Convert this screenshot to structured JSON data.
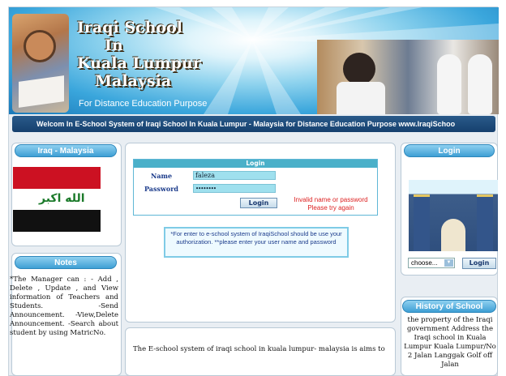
{
  "header": {
    "title_lines": [
      "Iraqi School",
      "In",
      "Kuala Lumpur",
      "Malaysia"
    ],
    "subtitle": "For Distance Education Purpose",
    "marquee": "Welcom In E-School System of Iraqi School In Kuala Lumpur - Malaysia for Distance Education Purpose www.IraqiSchoo"
  },
  "left": {
    "flag_title": "Iraq - Malaysia",
    "flag_text": "الله اكبر",
    "notes_title": "Notes",
    "notes_text": "*The Manager can : - Add , Delete , Update , and View information of Teachers and Students. -Send Announcement. -View,Delete Announcement. -Search about student by using MatricNo."
  },
  "login": {
    "header": "Login",
    "name_label": "Name",
    "name_value": "faleza",
    "password_label": "Password",
    "password_value": "••••••••",
    "button": "Login",
    "error": "Invalid name or password Please try again",
    "info": "*For enter to e-school system of IraqiSchool should be use your authorization. **please enter your user name and password",
    "intro": "The E-school system of iraqi school in kuala lumpur- malaysia is aims to"
  },
  "right": {
    "login_title": "Login",
    "select_value": "choose...",
    "login_button": "Login",
    "history_title": "History of School",
    "history_text": "the property of the Iraqi government Address the Iraqi school in Kuala Lumpur Kuala Lumpur/No 2 Jalan Langgak Golf off Jalan"
  },
  "colors": {
    "accent": "#3e9fd4",
    "error": "#dd2222",
    "link": "#1c3c8c"
  }
}
